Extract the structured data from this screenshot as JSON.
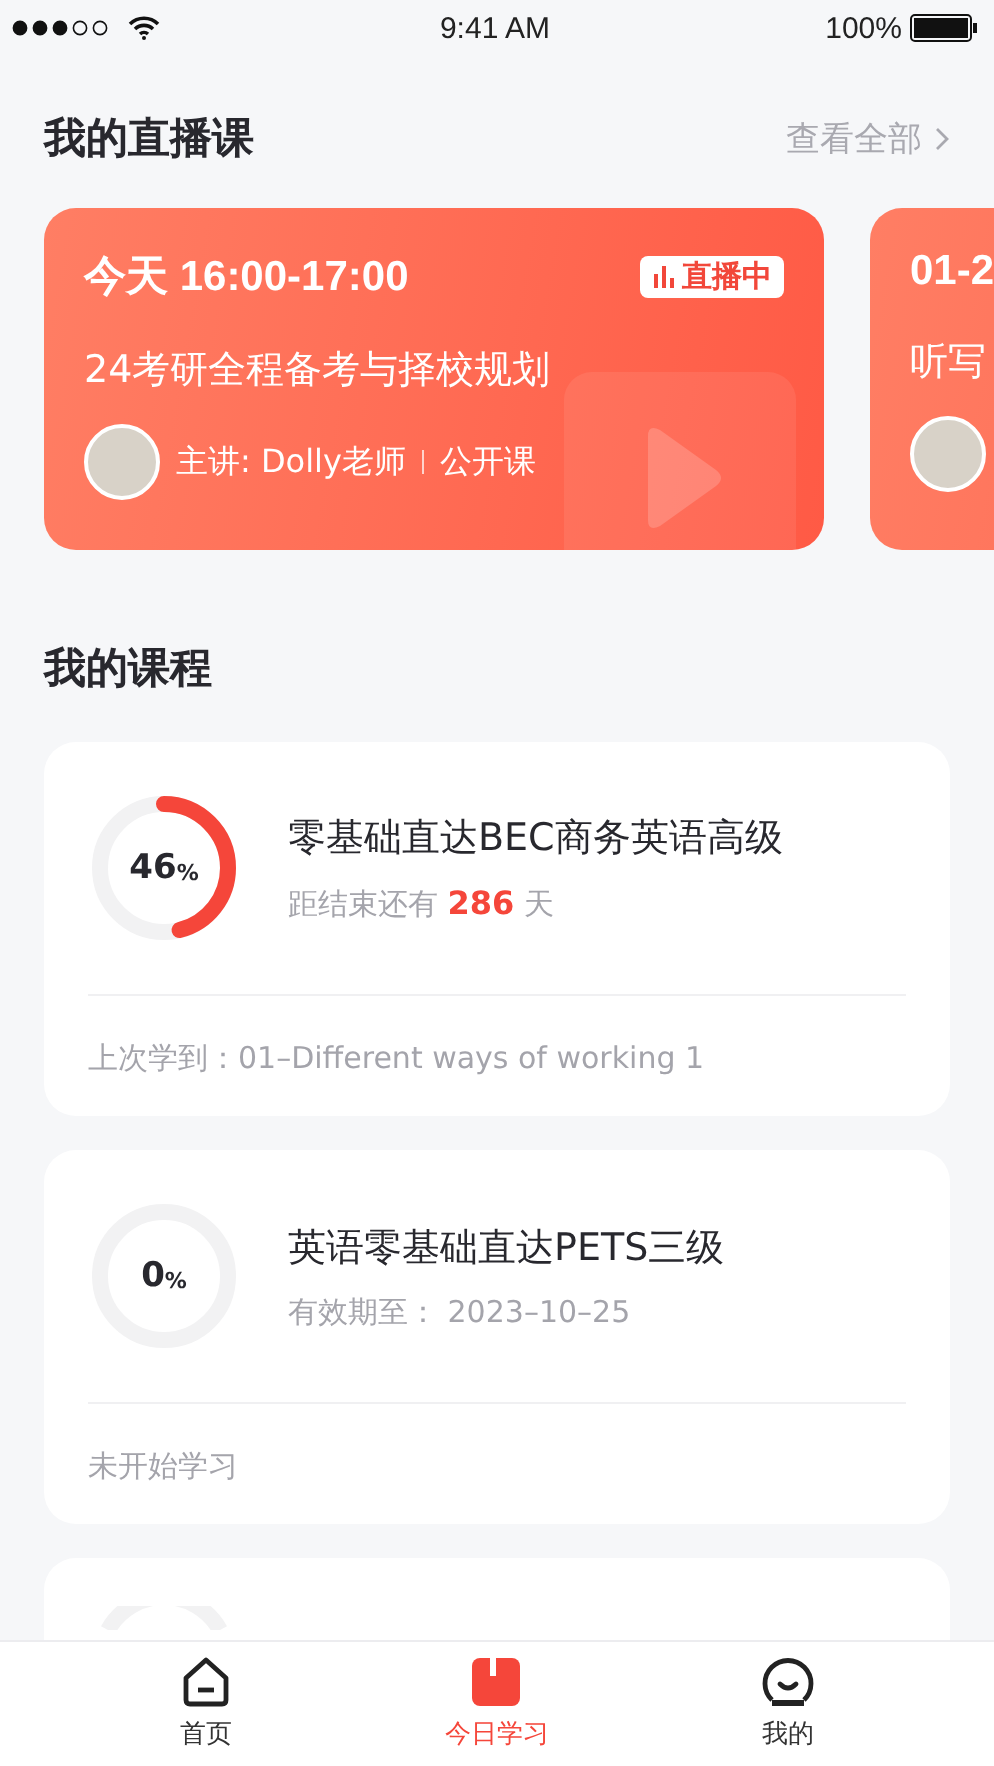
{
  "status_bar": {
    "time": "9:41 AM",
    "battery": "100%"
  },
  "live_section": {
    "title": "我的直播课",
    "see_all": "查看全部"
  },
  "live_courses": [
    {
      "time": "今天 16:00-17:00",
      "badge": "直播中",
      "title": "24考研全程备考与择校规划",
      "teacher": "主讲: Dolly老师",
      "tag": "公开课"
    },
    {
      "time": "01-2",
      "title": "听写"
    }
  ],
  "course_section": {
    "title": "我的课程"
  },
  "courses": [
    {
      "kind": "countdown",
      "level": 0.46,
      "percent": "46",
      "percent_sign": "%",
      "title": "零基础直达BEC商务英语高级",
      "prefix": "距结束还有",
      "days": "286",
      "suffix": "天",
      "footer": "上次学到：01–Different ways of working 1"
    },
    {
      "kind": "expiry",
      "level": 0,
      "percent": "0",
      "percent_sign": "%",
      "title": "英语零基础直达PETS三级",
      "prefix": "有效期至：",
      "date": "2023–10–25",
      "footer": "未开始学习"
    }
  ],
  "tabs": [
    {
      "label": "首页",
      "selected": false
    },
    {
      "label": "今日学习",
      "selected": true
    },
    {
      "label": "我的",
      "selected": false
    }
  ]
}
